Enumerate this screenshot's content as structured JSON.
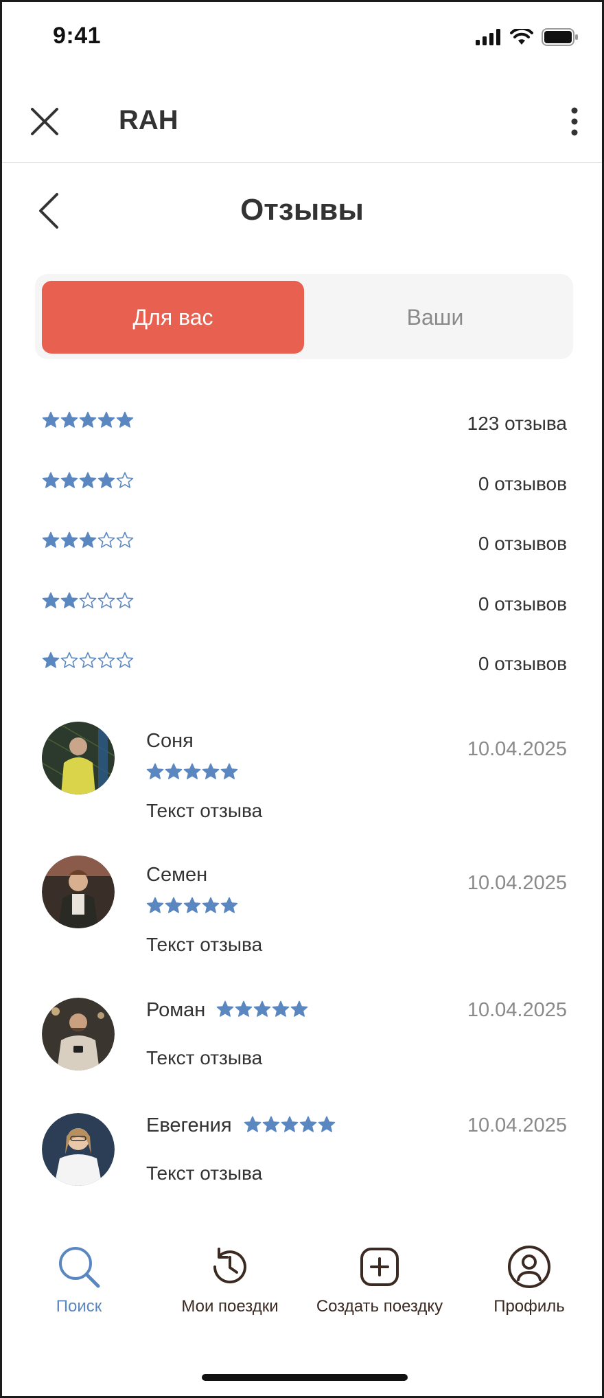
{
  "status_bar": {
    "time": "9:41"
  },
  "app_bar": {
    "title": "RAH"
  },
  "page": {
    "title": "Отзывы"
  },
  "tabs": [
    {
      "label": "Для вас",
      "active": true
    },
    {
      "label": "Ваши",
      "active": false
    }
  ],
  "rating_summary": [
    {
      "stars": 5,
      "count_label": "123 отзыва"
    },
    {
      "stars": 4,
      "count_label": "0 отзывов"
    },
    {
      "stars": 3,
      "count_label": "0 отзывов"
    },
    {
      "stars": 2,
      "count_label": "0 отзывов"
    },
    {
      "stars": 1,
      "count_label": "0 отзывов"
    }
  ],
  "reviews": [
    {
      "name": "Соня",
      "date": "10.04.2025",
      "text": "Текст отзыва",
      "rating": 5
    },
    {
      "name": "Семен",
      "date": "10.04.2025",
      "text": "Текст отзыва",
      "rating": 5
    },
    {
      "name": "Роман",
      "date": "10.04.2025",
      "text": "Текст отзыва",
      "rating": 5
    },
    {
      "name": "Евегения",
      "date": "10.04.2025",
      "text": "Текст отзыва",
      "rating": 5
    }
  ],
  "bottom_nav": [
    {
      "label": "Поиск",
      "icon": "search-icon",
      "active": true
    },
    {
      "label": "Мои поездки",
      "icon": "history-icon",
      "active": false
    },
    {
      "label": "Создать поездку",
      "icon": "add-square-icon",
      "active": false
    },
    {
      "label": "Профиль",
      "icon": "profile-icon",
      "active": false
    }
  ],
  "colors": {
    "accent": "#e8604f",
    "star": "#5b87c1",
    "nav_active": "#5b87c1",
    "nav_inactive": "#3a2a22"
  }
}
